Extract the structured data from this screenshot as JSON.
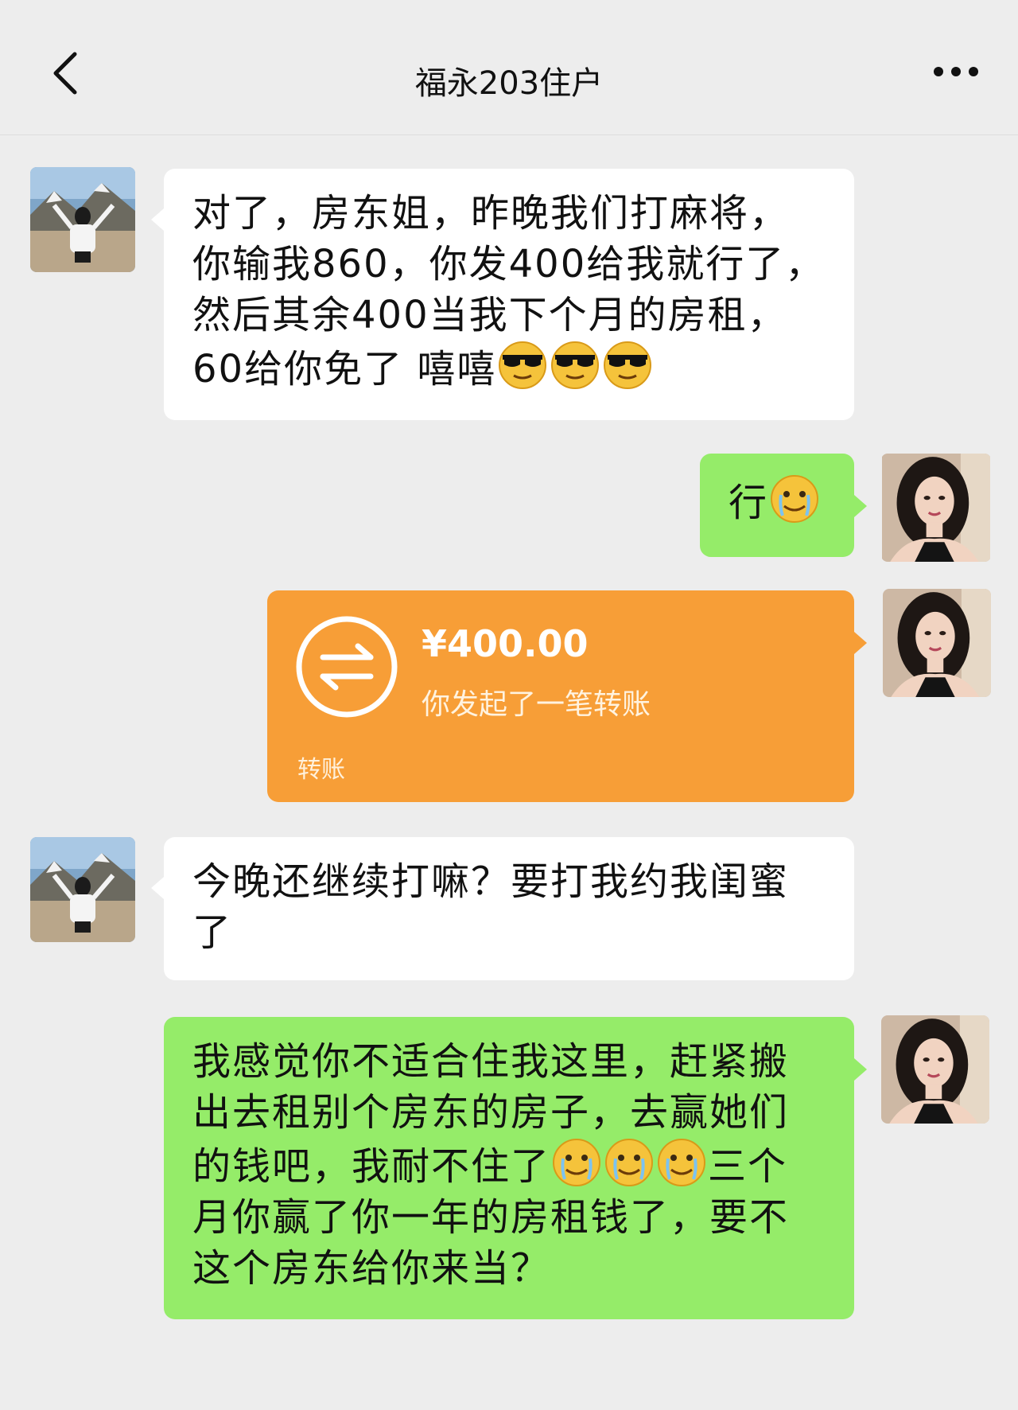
{
  "header": {
    "title": "福永203住户"
  },
  "messages": {
    "m1": {
      "text": "对了，房东姐，昨晚我们打麻将，你输我860，你发400给我就行了，然后其余400当我下个月的房租，60给你免了 嘻嘻",
      "emojis": [
        "sunglasses-emoji",
        "sunglasses-emoji",
        "sunglasses-emoji"
      ]
    },
    "m2": {
      "text": "行",
      "emojis": [
        "tearful-smile-emoji"
      ]
    },
    "m3": {
      "amount": "¥400.00",
      "desc": "你发起了一笔转账",
      "footer": "转账"
    },
    "m4": {
      "text": "今晚还继续打嘛？要打我约我闺蜜了"
    },
    "m5": {
      "text_before": "我感觉你不适合住我这里，赶紧搬出去租别个房东的房子，去赢她们的钱吧，我耐不住了",
      "text_after": "三个月你赢了你一年的房租钱了，要不这个房东给你来当？",
      "emojis": [
        "tearful-smile-emoji",
        "tearful-smile-emoji",
        "tearful-smile-emoji"
      ]
    }
  },
  "colors": {
    "background": "#ededed",
    "incoming_bubble": "#ffffff",
    "outgoing_bubble": "#95ec69",
    "transfer_card": "#f79e37"
  },
  "icons": [
    "back-arrow-icon",
    "more-dots-icon",
    "transfer-arrows-icon"
  ]
}
